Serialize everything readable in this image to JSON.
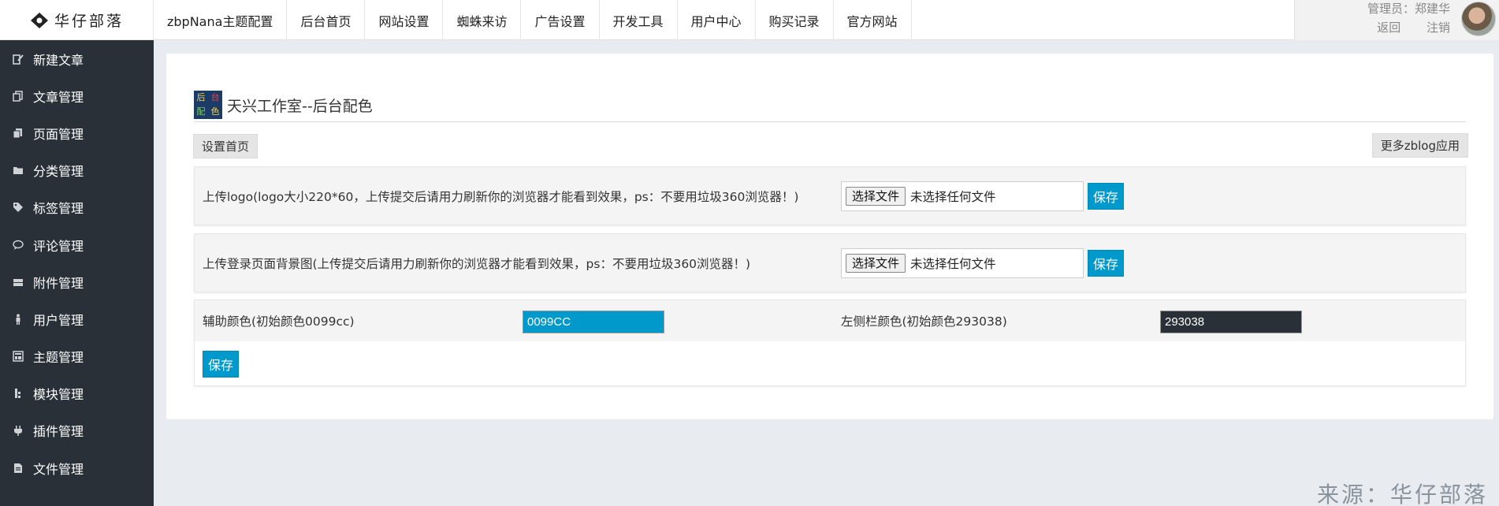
{
  "brand": {
    "logo_text": "华仔部落"
  },
  "nav": {
    "items": [
      "zbpNana主题配置",
      "后台首页",
      "网站设置",
      "蜘蛛来访",
      "广告设置",
      "开发工具",
      "用户中心",
      "购买记录",
      "官方网站"
    ]
  },
  "user": {
    "admin_label": "管理员：郑建华",
    "back_label": "返回",
    "logout_label": "注销"
  },
  "sidebar": {
    "items": [
      {
        "label": "新建文章",
        "icon": "edit-icon"
      },
      {
        "label": "文章管理",
        "icon": "documents-icon"
      },
      {
        "label": "页面管理",
        "icon": "pages-icon"
      },
      {
        "label": "分类管理",
        "icon": "folder-icon"
      },
      {
        "label": "标签管理",
        "icon": "tag-icon"
      },
      {
        "label": "评论管理",
        "icon": "comment-icon"
      },
      {
        "label": "附件管理",
        "icon": "hdd-icon"
      },
      {
        "label": "用户管理",
        "icon": "user-icon"
      },
      {
        "label": "主题管理",
        "icon": "theme-icon"
      },
      {
        "label": "模块管理",
        "icon": "module-icon"
      },
      {
        "label": "插件管理",
        "icon": "plugin-icon"
      },
      {
        "label": "文件管理",
        "icon": "file-icon"
      }
    ]
  },
  "main": {
    "title": "天兴工作室--后台配色",
    "title_logo": [
      "后",
      "台",
      "配",
      "色"
    ],
    "home_button": "设置首页",
    "more_button": "更多zblog应用",
    "upload_logo": {
      "label": "上传logo(logo大小220*60，上传提交后请用力刷新你的浏览器才能看到效果，ps：不要用垃圾360浏览器！)",
      "file_button": "选择文件",
      "file_status": "未选择任何文件",
      "save_label": "保存"
    },
    "upload_bg": {
      "label": "上传登录页面背景图(上传提交后请用力刷新你的浏览器才能看到效果，ps：不要用垃圾360浏览器！)",
      "file_button": "选择文件",
      "file_status": "未选择任何文件",
      "save_label": "保存"
    },
    "colors": {
      "aux_label": "辅助颜色(初始颜色0099cc)",
      "aux_value": "0099CC",
      "sidebar_label": "左侧栏颜色(初始颜色293038)",
      "sidebar_value": "293038",
      "save_label": "保存"
    }
  },
  "watermark": "来源：华仔部落",
  "theme": {
    "accent": "#0099cc",
    "sidebar": "#293038"
  }
}
